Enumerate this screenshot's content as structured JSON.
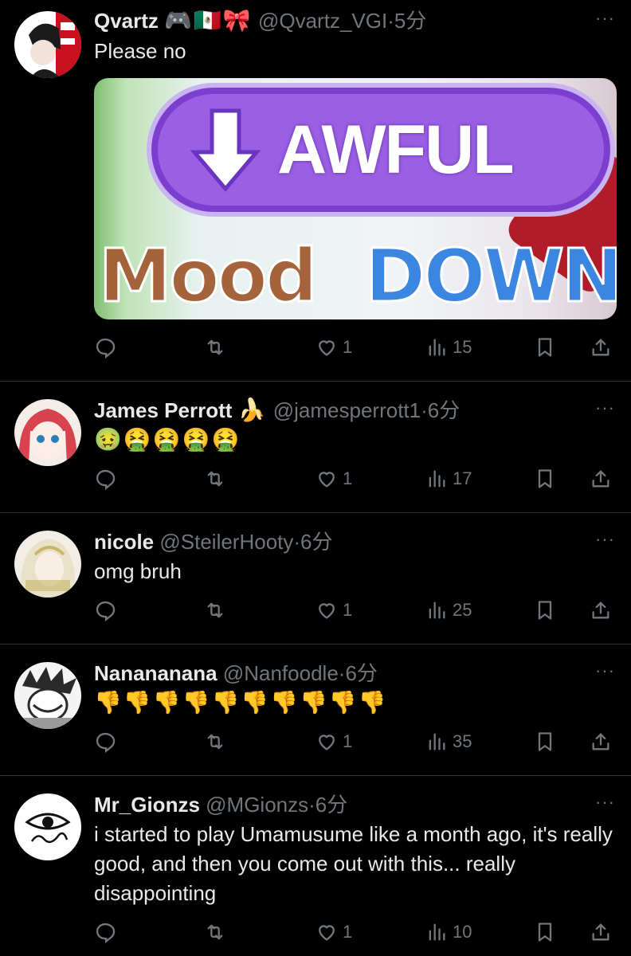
{
  "tweets": [
    {
      "name": "Qvartz",
      "name_badges": "🎮🇲🇽🎀",
      "handle": "@Qvartz_VGI",
      "time": "·5分",
      "text": "Please no",
      "media": {
        "top_text": "AWFUL",
        "bottom_left": "Mood",
        "bottom_right": "DOWN"
      },
      "likes": "1",
      "views": "15",
      "avatar_colors": [
        "#ffffff",
        "#c8101f",
        "#1b1b1b"
      ]
    },
    {
      "name": "James Perrott",
      "name_badges": "🍌",
      "handle": "@jamesperrott1",
      "time": "·6分",
      "text": "🤢🤮🤮🤮🤮",
      "likes": "1",
      "views": "17",
      "avatar_colors": [
        "#f4ece6",
        "#d8434f",
        "#2a7fb8"
      ]
    },
    {
      "name": "nicole",
      "name_badges": "",
      "handle": "@SteilerHooty",
      "time": "·6分",
      "text": "omg bruh",
      "likes": "1",
      "views": "25",
      "avatar_colors": [
        "#f2eee6",
        "#c9b66a",
        "#7a6b4e"
      ]
    },
    {
      "name": "Nanananana",
      "name_badges": "",
      "handle": "@Nanfoodle",
      "time": "·6分",
      "text": "👎👎👎👎👎👎👎👎👎👎",
      "likes": "1",
      "views": "35",
      "avatar_colors": [
        "#f4f4f4",
        "#2a2a2a",
        "#9a9a9a"
      ]
    },
    {
      "name": "Mr_Gionzs",
      "name_badges": "",
      "handle": "@MGionzs",
      "time": "·6分",
      "text": "i started to play Umamusume like a month ago, it's really good, and then you come out with this... really disappointing",
      "likes": "1",
      "views": "10",
      "avatar_colors": [
        "#ffffff",
        "#111111",
        "#111111"
      ]
    }
  ],
  "more_label": "···",
  "icons": [
    "reply-icon",
    "retweet-icon",
    "like-icon",
    "views-icon",
    "bookmark-icon",
    "share-icon"
  ]
}
